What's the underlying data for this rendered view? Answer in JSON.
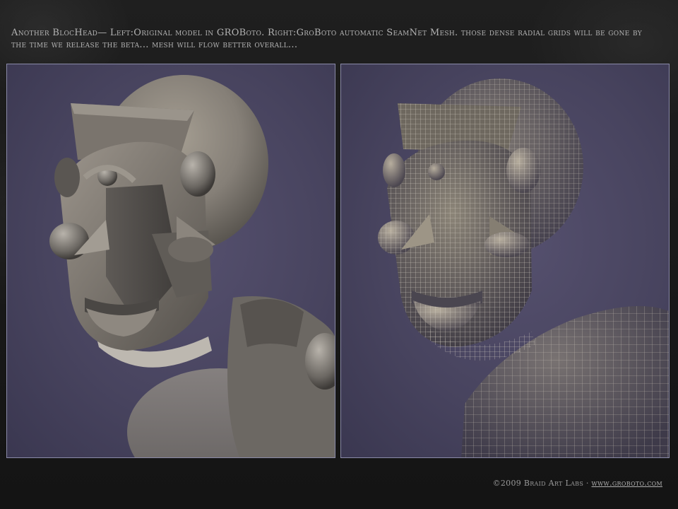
{
  "caption": "Another BlocHead— Left:Original model in GROBoto. Right:GroBoto automatic SeamNet Mesh. those dense radial grids will be gone by the time we release the beta... mesh will flow better overall...",
  "footer": {
    "copyright": "©2009 Braid Art Labs ·",
    "link_text": "www.groboto.com"
  },
  "colors": {
    "background": "#1d1d1d",
    "panel_bg": "#48445f",
    "panel_border": "#8a8aa8",
    "caption_text": "#b3b3b3"
  },
  "icons": {
    "left_panel": "shaded-blochead-render",
    "right_panel": "wireframe-blochead-render"
  }
}
